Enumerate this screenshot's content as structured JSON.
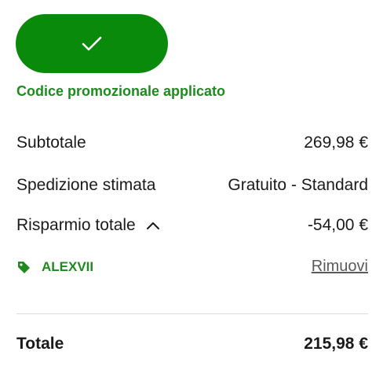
{
  "promo": {
    "button_icon": "check-icon",
    "applied_message": "Codice promozionale applicato",
    "accent_color": "#0a8a0a"
  },
  "summary": {
    "subtotal_label": "Subtotale",
    "subtotal_value": "269,98 €",
    "shipping_label": "Spedizione stimata",
    "shipping_value": "Gratuito - Standard",
    "savings_label": "Risparmio totale",
    "savings_toggle_icon": "chevron-up-icon",
    "savings_value": "-54,00 €",
    "code_icon": "tag-icon",
    "code": "ALEXVII",
    "remove_label": "Rimuovi",
    "total_label": "Totale",
    "total_value": "215,98 €"
  }
}
